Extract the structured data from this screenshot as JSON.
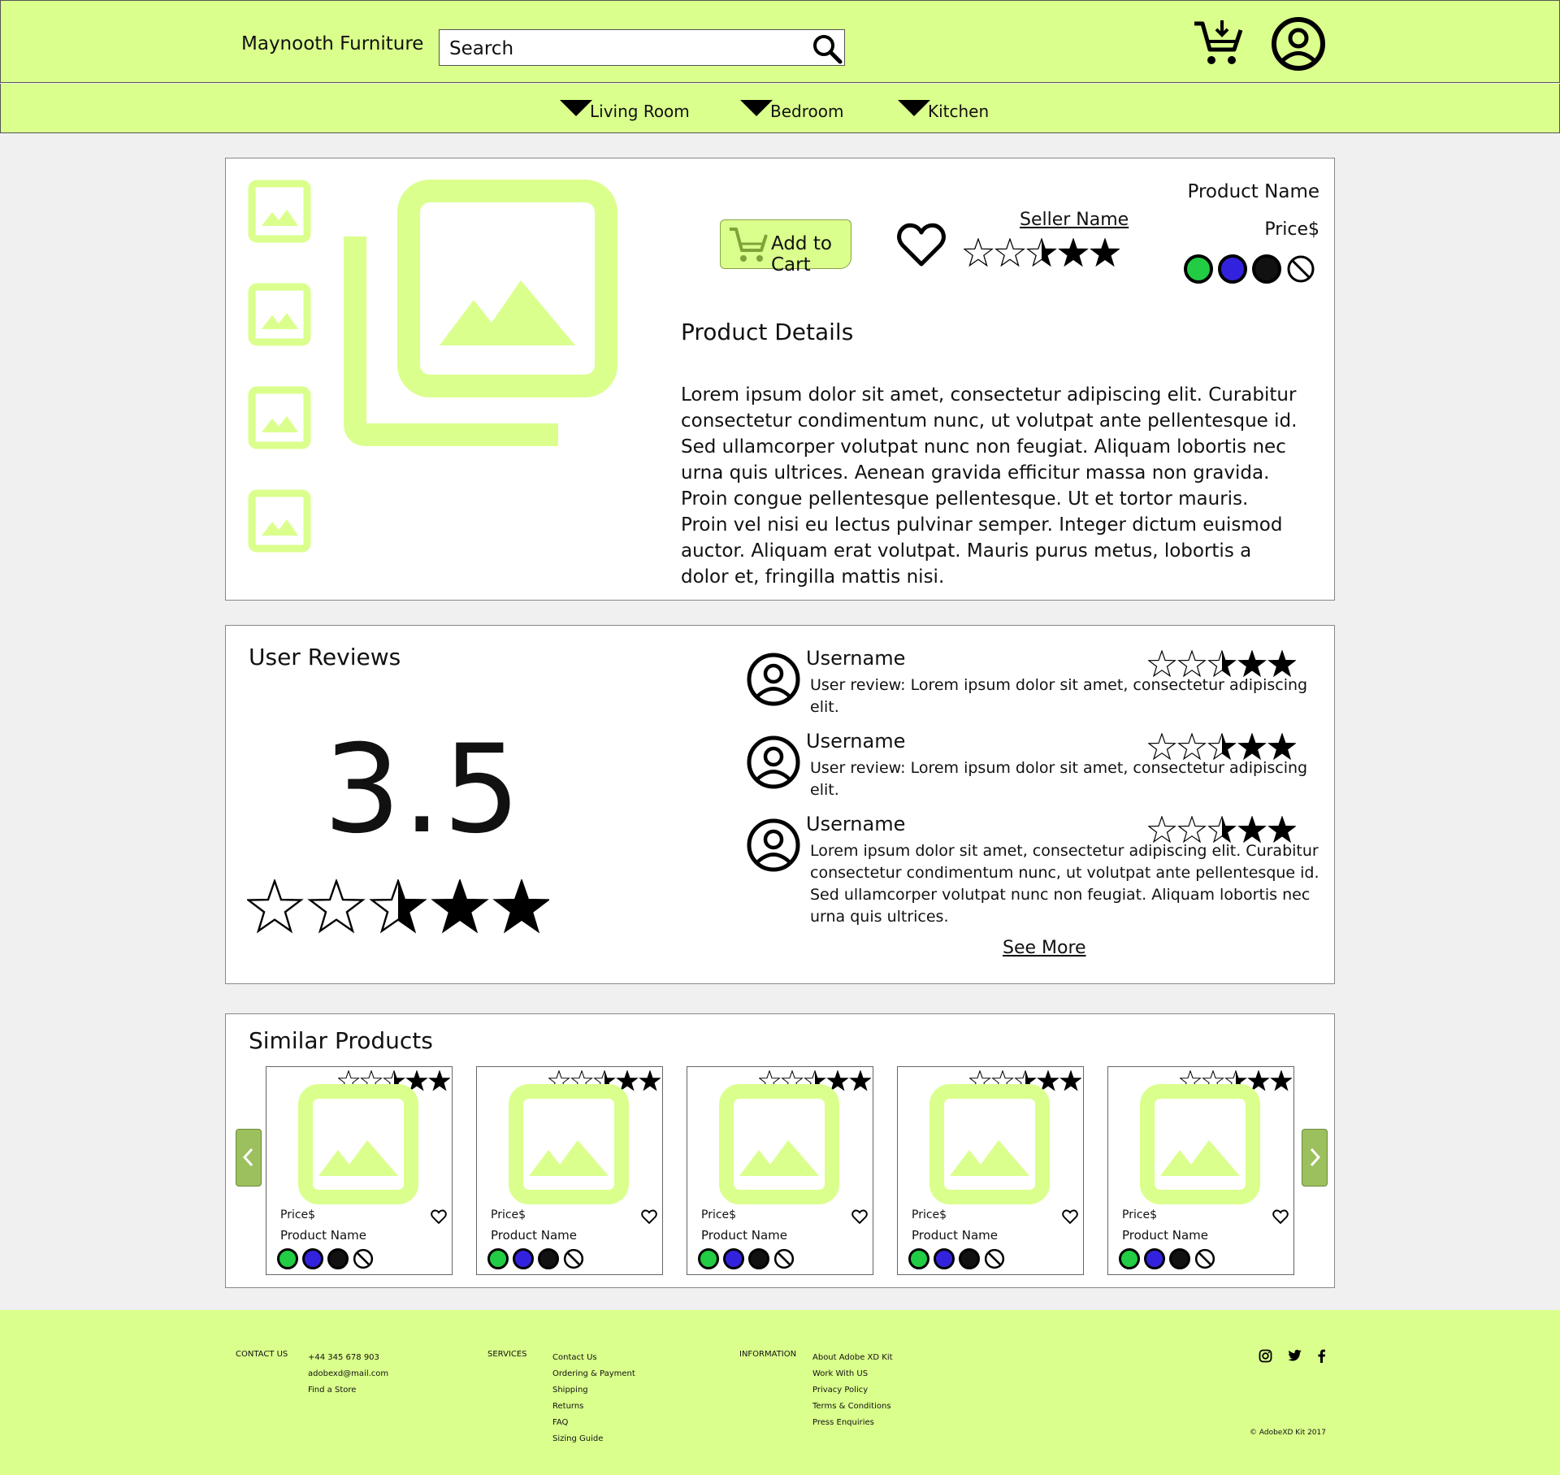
{
  "header": {
    "brand": "Maynooth Furniture",
    "search_placeholder": "Search",
    "colors": {
      "accent": "#daff8c",
      "accent_dark": "#9dc05f"
    }
  },
  "nav": {
    "items": [
      {
        "label": "Living Room"
      },
      {
        "label": "Bedroom"
      },
      {
        "label": "Kitchen"
      }
    ]
  },
  "product": {
    "name": "Product Name",
    "price": "Price$",
    "seller": "Seller Name",
    "add_to_cart": "Add to Cart",
    "rating_stars": 3.5,
    "swatches": [
      "#22cc44",
      "#3322dd",
      "#111111",
      "none"
    ],
    "details_title": "Product Details",
    "details_text": "Lorem ipsum dolor sit amet, consectetur adipiscing elit. Curabitur consectetur condimentum nunc, ut volutpat ante pellentesque id. Sed ullamcorper volutpat nunc non feugiat. Aliquam lobortis nec urna quis ultrices. Aenean gravida efficitur massa non gravida. Proin congue pellentesque pellentesque. Ut et tortor mauris. Proin vel nisi eu lectus pulvinar semper. Integer dictum euismod auctor. Aliquam erat volutpat. Mauris purus metus, lobortis a dolor et, fringilla mattis nisi."
  },
  "reviews": {
    "title": "User Reviews",
    "average": "3.5",
    "items": [
      {
        "username": "Username",
        "text": "User review: Lorem ipsum dolor sit amet, consectetur adipiscing elit."
      },
      {
        "username": "Username",
        "text": "User review: Lorem ipsum dolor sit amet, consectetur adipiscing elit."
      },
      {
        "username": "Username",
        "text": "Lorem ipsum dolor sit amet, consectetur adipiscing elit. Curabitur consectetur condimentum nunc, ut volutpat ante pellentesque id. Sed ullamcorper volutpat nunc non feugiat. Aliquam lobortis nec urna quis ultrices."
      }
    ],
    "see_more": "See More"
  },
  "similar": {
    "title": "Similar Products",
    "cards": [
      {
        "price": "Price$",
        "name": "Product Name"
      },
      {
        "price": "Price$",
        "name": "Product Name"
      },
      {
        "price": "Price$",
        "name": "Product Name"
      },
      {
        "price": "Price$",
        "name": "Product Name"
      },
      {
        "price": "Price$",
        "name": "Product Name"
      }
    ]
  },
  "footer": {
    "contact_heading": "CONTACT US",
    "contact": [
      "+44 345 678 903",
      "adobexd@mail.com",
      "Find a Store"
    ],
    "services_heading": "SERVICES",
    "services": [
      "Contact Us",
      "Ordering & Payment",
      "Shipping",
      "Returns",
      "FAQ",
      "Sizing Guide"
    ],
    "information_heading": "INFORMATION",
    "information": [
      "About Adobe XD Kit",
      "Work With US",
      "Privacy Policy",
      "Terms & Conditions",
      "Press Enquiries"
    ],
    "copyright": "© AdobeXD Kit 2017",
    "social_icons": [
      "instagram-icon",
      "twitter-icon",
      "facebook-icon"
    ]
  }
}
